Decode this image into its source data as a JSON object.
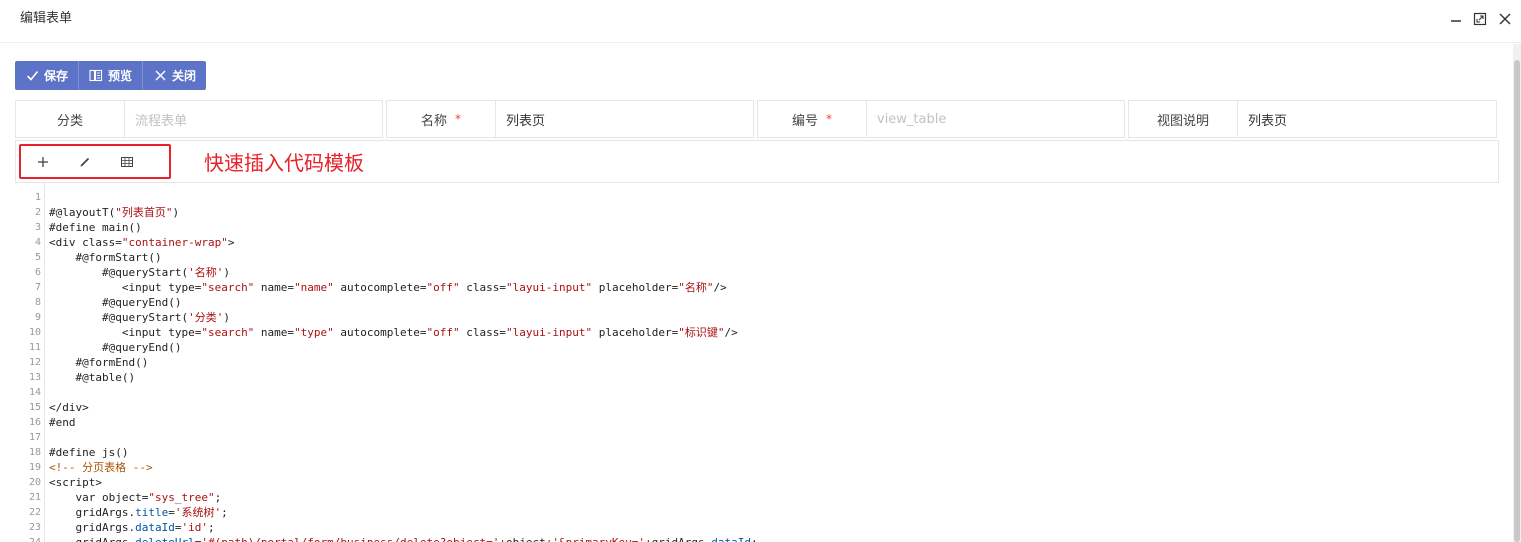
{
  "window": {
    "title": "编辑表单"
  },
  "toolbar": {
    "save_label": "保存",
    "preview_label": "预览",
    "close_label": "关闭"
  },
  "form": {
    "category": {
      "label": "分类",
      "placeholder": "流程表单",
      "value": ""
    },
    "name": {
      "label": "名称",
      "required_mark": "*",
      "value": "列表页"
    },
    "code": {
      "label": "编号",
      "required_mark": "*",
      "placeholder": "view_table",
      "value": ""
    },
    "description": {
      "label": "视图说明",
      "value": "列表页"
    }
  },
  "code_toolbar": {
    "icons": [
      "plus-icon",
      "pencil-icon",
      "table-icon"
    ],
    "annotation": "快速插入代码模板"
  },
  "editor": {
    "lines": [
      "",
      "#@layoutT(\"列表首页\")",
      "#define main()",
      "<div class=\"container-wrap\">",
      "    #@formStart()",
      "        #@queryStart('名称')",
      "           <input type=\"search\" name=\"name\" autocomplete=\"off\" class=\"layui-input\" placeholder=\"名称\"/>",
      "        #@queryEnd()",
      "        #@queryStart('分类')",
      "           <input type=\"search\" name=\"type\" autocomplete=\"off\" class=\"layui-input\" placeholder=\"标识键\"/>",
      "        #@queryEnd()",
      "    #@formEnd()",
      "    #@table()",
      "",
      "</div>",
      "#end",
      "",
      "#define js()",
      "<!-- 分页表格 -->",
      "<script>",
      "    var object=\"sys_tree\";",
      "    gridArgs.title='系统树';",
      "    gridArgs.dataId='id';",
      "    gridArgs.deleteUrl='#(path)/portal/form/business/delete?object='+object+'&primaryKey='+gridArgs.dataId;"
    ]
  }
}
